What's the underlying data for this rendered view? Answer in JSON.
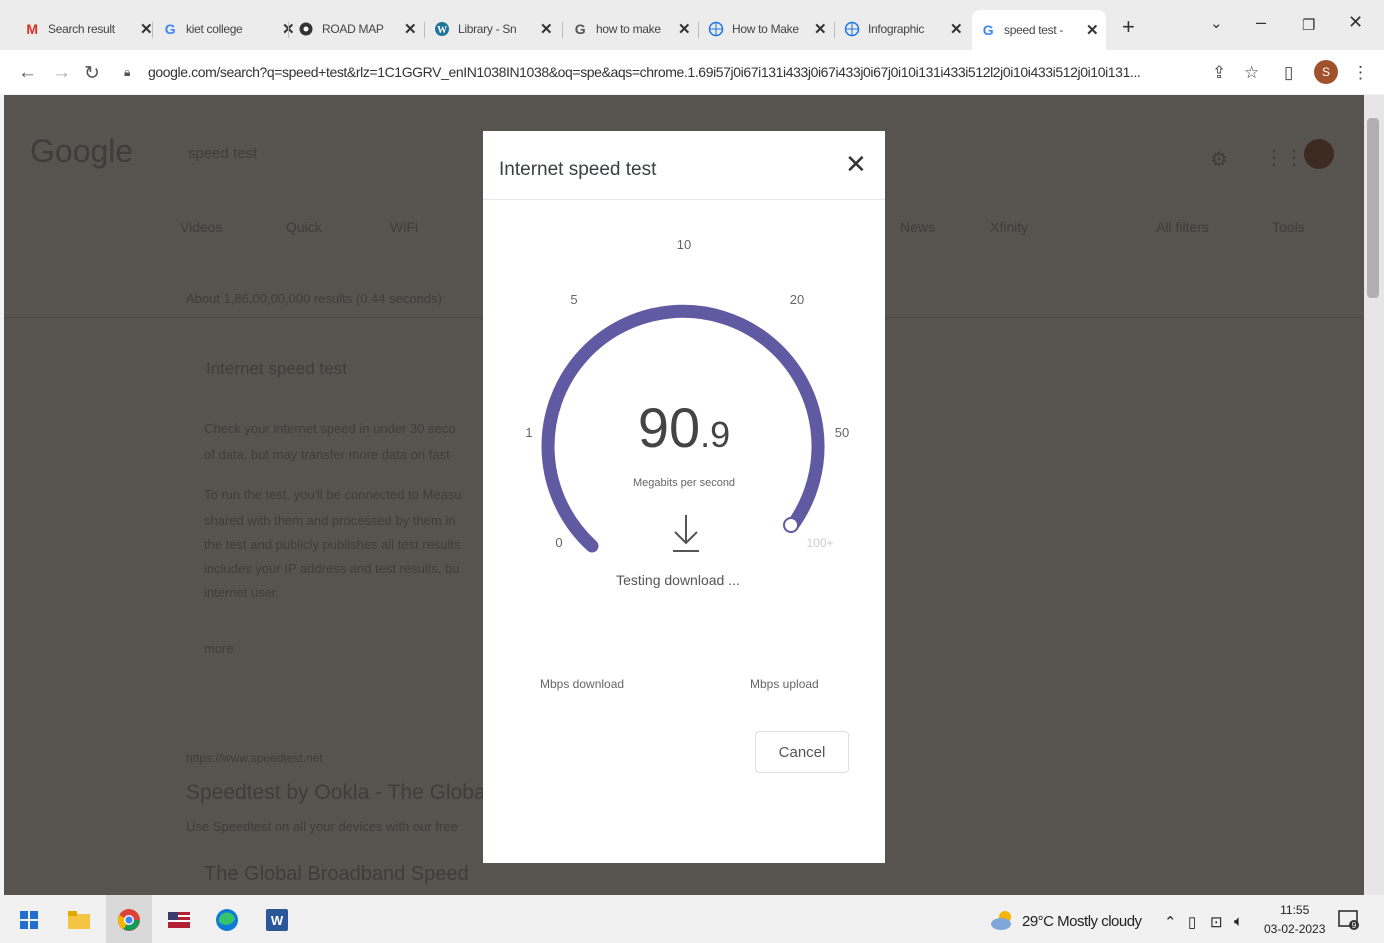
{
  "browser": {
    "tabs": [
      {
        "title": "Search result",
        "icon": "gmail-icon"
      },
      {
        "title": "kiet college",
        "icon": "google-icon"
      },
      {
        "title": "ROAD MAP",
        "icon": "chatgpt-icon"
      },
      {
        "title": "Library - Sn",
        "icon": "wordpress-icon"
      },
      {
        "title": "how to make",
        "icon": "google-icon"
      },
      {
        "title": "How to Make",
        "icon": "globe-icon"
      },
      {
        "title": "Infographic",
        "icon": "globe-icon"
      },
      {
        "title": "speed test -",
        "icon": "google-icon",
        "active": true
      }
    ],
    "url": "google.com/search?q=speed+test&rlz=1C1GGRV_enIN1038IN1038&oq=spe&aqs=chrome.1.69i57j0i67i131i433j0i67i433j0i67j0i10i131i433i512l2j0i10i433i512j0i10i131...",
    "profile_initial": "S"
  },
  "background_page": {
    "logo": "Google",
    "query": "speed test",
    "filters": [
      "Videos",
      "Quick",
      "WiFi",
      "News",
      "Xfinity",
      "All filters",
      "Tools"
    ],
    "result_stats": "About 1,86,00,00,000 results (0.44 seconds)",
    "card_title": "Internet speed test",
    "card_text": [
      "Check your internet speed in under 30 seco",
      "of data, but may transfer more data on fast",
      "To run the test, you'll be connected to Measu",
      "shared with them and processed by them in",
      "the test and publicly publishes all test results",
      "includes your IP address and test results, bu",
      "internet user."
    ],
    "learn_more": "more",
    "result_url": "https://www.speedtest.net",
    "result_title": "Speedtest by Ookla - The Global",
    "result_snippet": "Use Speedtest on all your devices with our free",
    "result_heading": "The Global Broadband Speed"
  },
  "modal": {
    "title": "Internet speed test",
    "gauge_ticks": [
      "0",
      "1",
      "5",
      "10",
      "20",
      "50",
      "100+"
    ],
    "speed_int": "90",
    "speed_dec": ".9",
    "units": "Megabits per second",
    "status": "Testing download ...",
    "download_label": "Mbps download",
    "upload_label": "Mbps upload",
    "cancel_label": "Cancel",
    "accent_color": "#5f5aa2"
  },
  "taskbar": {
    "weather": "29°C  Mostly cloudy",
    "time": "11:55",
    "date": "03-02-2023",
    "notifications": "9"
  }
}
